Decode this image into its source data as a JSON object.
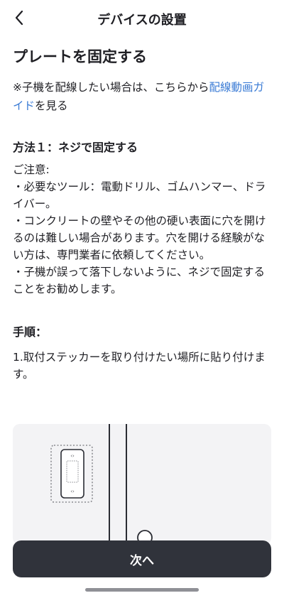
{
  "nav": {
    "title": "デバイスの設置"
  },
  "page": {
    "heading": "プレートを固定する",
    "note_prefix": "※子機を配線したい場合は、こちらから",
    "note_link": "配線動画ガイド",
    "note_suffix": "を見る"
  },
  "method1": {
    "title": "方法１：ネジで固定する",
    "caution_label": "ご注意:",
    "caution_items": [
      "・必要なツール：電動ドリル、ゴムハンマー、ドライバー。",
      "・コンクリートの壁やその他の硬い表面に穴を開けるのは難しい場合があります。穴を開ける経験がない方は、専門業者に依頼してください。",
      "・子機が誤って落下しないように、ネジで固定することをお勧めします。"
    ]
  },
  "steps": {
    "title": "手順：",
    "items": [
      "1.取付ステッカーを取り付けたい場所に貼り付けます。"
    ]
  },
  "footer": {
    "next_label": "次へ"
  },
  "icons": {
    "back": "chevron-left-icon"
  },
  "colors": {
    "link": "#3a7bd5",
    "button_bg": "#30333b",
    "illustration_bg": "#f3f3f5"
  }
}
